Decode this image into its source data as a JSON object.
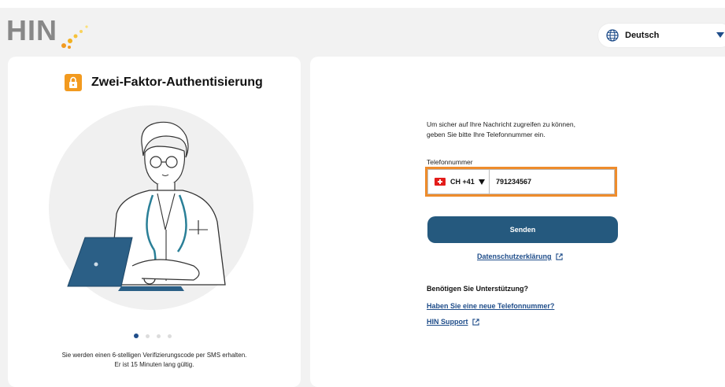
{
  "header": {
    "logo_text": "HIN",
    "language": {
      "label": "Deutsch",
      "icon": "globe-icon"
    }
  },
  "left_panel": {
    "title": "Zwei-Faktor-Authentisierung",
    "title_icon": "lock-icon",
    "carousel": {
      "total": 4,
      "active_index": 0
    },
    "caption_line1": "Sie werden einen 6-stelligen Verifizierungscode per SMS erhalten.",
    "caption_line2": "Er ist 15 Minuten lang gültig."
  },
  "form": {
    "intro_line1": "Um sicher auf Ihre Nachricht zugreifen zu können,",
    "intro_line2": "geben Sie bitte Ihre Telefonnummer ein.",
    "phone_label": "Telefonnummer",
    "country_code": "CH +41",
    "phone_value": "791234567",
    "send_label": "Senden",
    "privacy_link": "Datenschutzerklärung"
  },
  "help": {
    "title": "Benötigen Sie Unterstützung?",
    "new_number_link": "Haben Sie eine neue Telefonnummer?",
    "support_link": "HIN Support"
  },
  "colors": {
    "accent": "#25597e",
    "link": "#1f4d8a",
    "highlight": "#ee8c2c",
    "lock_icon_bg": "#f29a1f",
    "background": "#f2f2f2"
  }
}
